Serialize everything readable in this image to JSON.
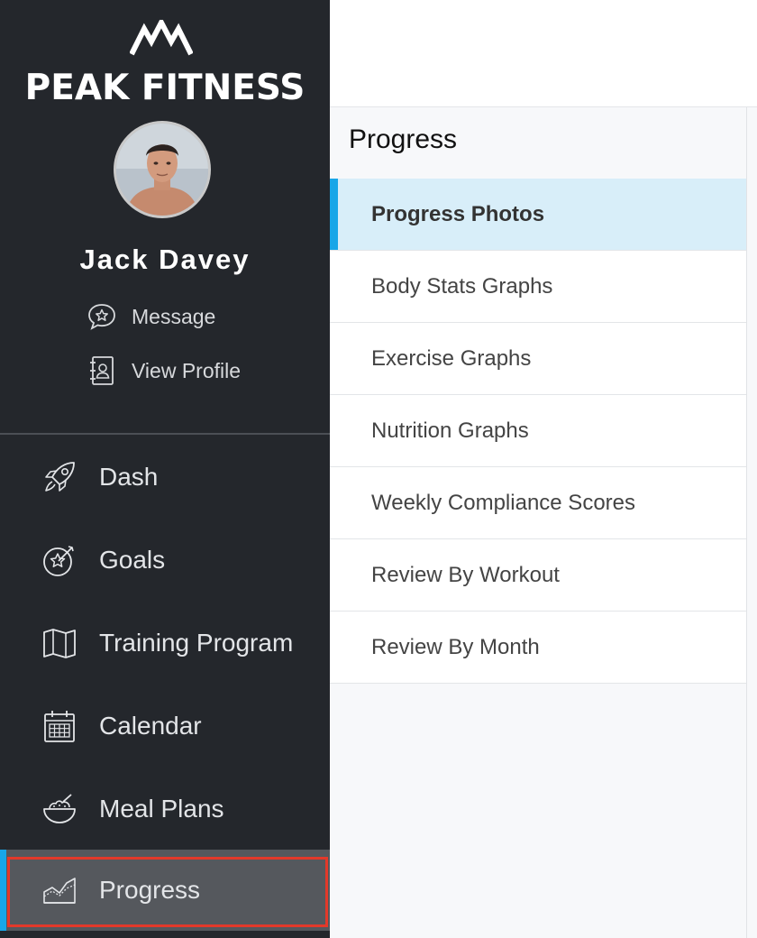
{
  "brand": {
    "name": "PEAK FITNESS"
  },
  "user": {
    "name": "Jack Davey"
  },
  "profile_links": [
    {
      "label": "Message",
      "icon": "message-star-icon"
    },
    {
      "label": "View Profile",
      "icon": "contact-card-icon"
    }
  ],
  "nav": {
    "items": [
      {
        "label": "Dash",
        "icon": "rocket-icon"
      },
      {
        "label": "Goals",
        "icon": "target-dart-icon"
      },
      {
        "label": "Training Program",
        "icon": "map-icon"
      },
      {
        "label": "Calendar",
        "icon": "calendar-icon"
      },
      {
        "label": "Meal Plans",
        "icon": "bowl-icon"
      },
      {
        "label": "Progress",
        "icon": "chart-icon"
      }
    ],
    "active": "Progress"
  },
  "submenu": {
    "title": "Progress",
    "items": [
      {
        "label": "Progress Photos"
      },
      {
        "label": "Body Stats Graphs"
      },
      {
        "label": "Exercise Graphs"
      },
      {
        "label": "Nutrition Graphs"
      },
      {
        "label": "Weekly Compliance Scores"
      },
      {
        "label": "Review By Workout"
      },
      {
        "label": "Review By Month"
      }
    ],
    "active": "Progress Photos"
  },
  "colors": {
    "sidebar_bg": "#24272c",
    "accent_blue": "#18a6e8",
    "highlight_red": "#e3392a",
    "active_sub_bg": "#d8eef9"
  }
}
